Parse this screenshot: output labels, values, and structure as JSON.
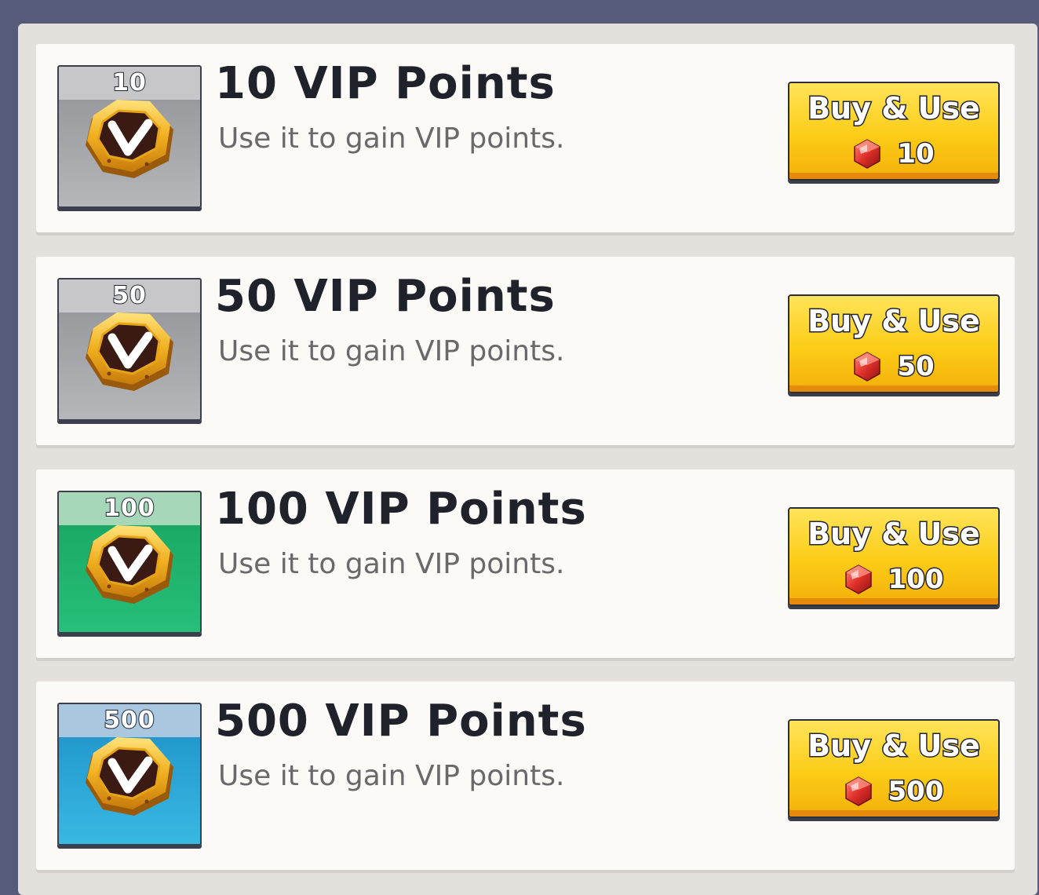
{
  "colors": {
    "backdrop": "#555b78",
    "panel": "#e4e0dc",
    "card": "#fcfaf7",
    "button": "#fccc16",
    "title_text": "#20222b",
    "desc_text": "#6b6869"
  },
  "items": [
    {
      "quantity": "10",
      "title": "10 VIP Points",
      "description": "Use it to gain VIP points.",
      "button_label": "Buy & Use",
      "price": "10",
      "icon": "vip-badge-icon",
      "icon_background": "gray",
      "currency_icon": "ruby-gem-icon"
    },
    {
      "quantity": "50",
      "title": "50 VIP Points",
      "description": "Use it to gain VIP points.",
      "button_label": "Buy & Use",
      "price": "50",
      "icon": "vip-badge-icon",
      "icon_background": "gray",
      "currency_icon": "ruby-gem-icon"
    },
    {
      "quantity": "100",
      "title": "100 VIP Points",
      "description": "Use it to gain VIP points.",
      "button_label": "Buy & Use",
      "price": "100",
      "icon": "vip-badge-icon",
      "icon_background": "green",
      "currency_icon": "ruby-gem-icon"
    },
    {
      "quantity": "500",
      "title": "500 VIP Points",
      "description": "Use it to gain VIP points.",
      "button_label": "Buy & Use",
      "price": "500",
      "icon": "vip-badge-icon",
      "icon_background": "blue",
      "currency_icon": "ruby-gem-icon"
    }
  ]
}
